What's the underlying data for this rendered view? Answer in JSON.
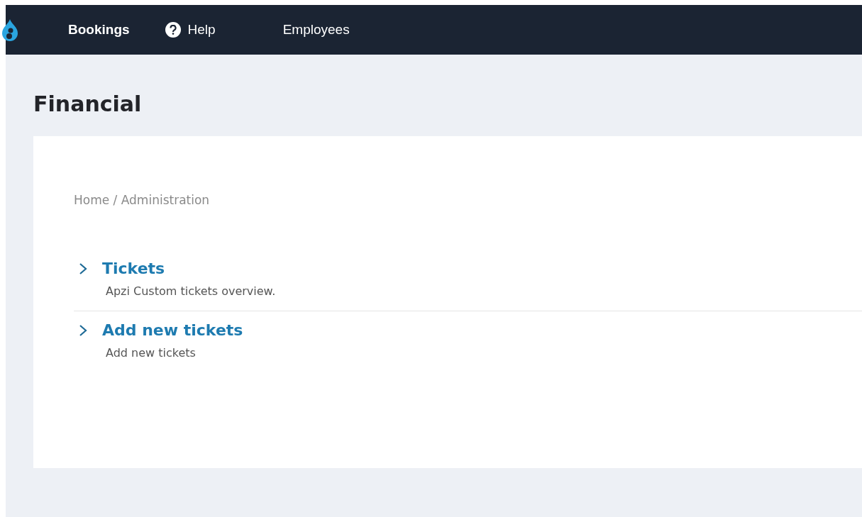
{
  "nav": {
    "items": [
      {
        "label": "Bookings",
        "kind": "text",
        "selected": true
      },
      {
        "label": "Help",
        "kind": "help",
        "selected": false
      },
      {
        "label": "Employees",
        "kind": "text",
        "selected": false
      }
    ]
  },
  "page": {
    "title": "Financial"
  },
  "breadcrumb": "Home / Administration",
  "entries": [
    {
      "title": "Tickets",
      "description": "Apzi Custom tickets overview."
    },
    {
      "title": "Add new tickets",
      "description": "Add new tickets"
    }
  ]
}
